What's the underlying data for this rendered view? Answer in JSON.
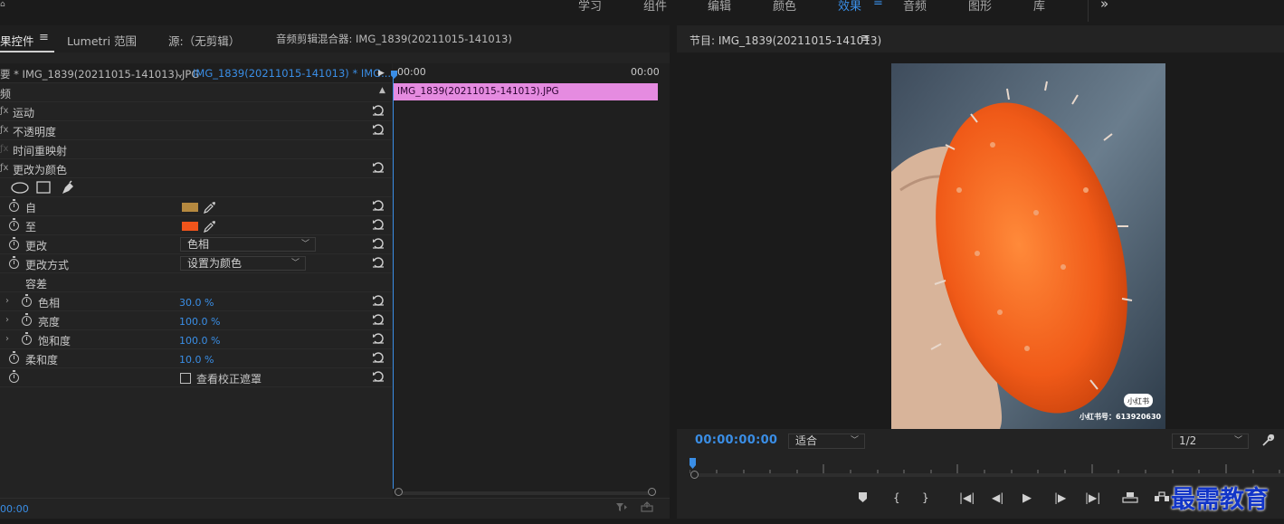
{
  "workspaces": {
    "items": [
      "学习",
      "组件",
      "编辑",
      "颜色",
      "效果",
      "音频",
      "图形",
      "库"
    ],
    "active": "效果",
    "more": "»"
  },
  "left_tabs": {
    "effects_controls": "果控件",
    "lumetri": "Lumetri 范围",
    "source": "源:（无剪辑）",
    "audio_mixer": "音频剪辑混合器: IMG_1839(20211015-141013)"
  },
  "clip_header": {
    "master": "要 * IMG_1839(20211015-141013).JPG",
    "sequence": "IMG_1839(20211015-141013) * IMG...",
    "time_start": "00:00",
    "time_end": "00:00"
  },
  "clip_bar_label": "IMG_1839(20211015-141013).JPG",
  "section_video": "频",
  "effects": {
    "motion": "运动",
    "opacity": "不透明度",
    "time_remap": "时间重映射",
    "change_to_color": "更改为颜色"
  },
  "params": {
    "from": "自",
    "to": "至",
    "change": "更改",
    "change_value": "色相",
    "change_by": "更改方式",
    "change_by_value": "设置为颜色",
    "tolerance": "容差",
    "hue": "色相",
    "hue_value": "30.0 %",
    "lightness": "亮度",
    "lightness_value": "100.0 %",
    "saturation": "饱和度",
    "saturation_value": "100.0 %",
    "softness": "柔和度",
    "softness_value": "10.0 %",
    "view_mask": "查看校正遮罩"
  },
  "colors": {
    "from_swatch": "#b5893f",
    "to_swatch": "#f0541b",
    "accent": "#3a8ee6",
    "clip": "#e58be0"
  },
  "left_footer_time": "00:00",
  "program": {
    "title": "节目: IMG_1839(20211015-141013)",
    "timecode": "00:00:00:00",
    "fit": "适合",
    "resolution": "1/2",
    "frame_brand": "小红书",
    "frame_id": "小红书号：613920630"
  },
  "watermark": "最需教育"
}
